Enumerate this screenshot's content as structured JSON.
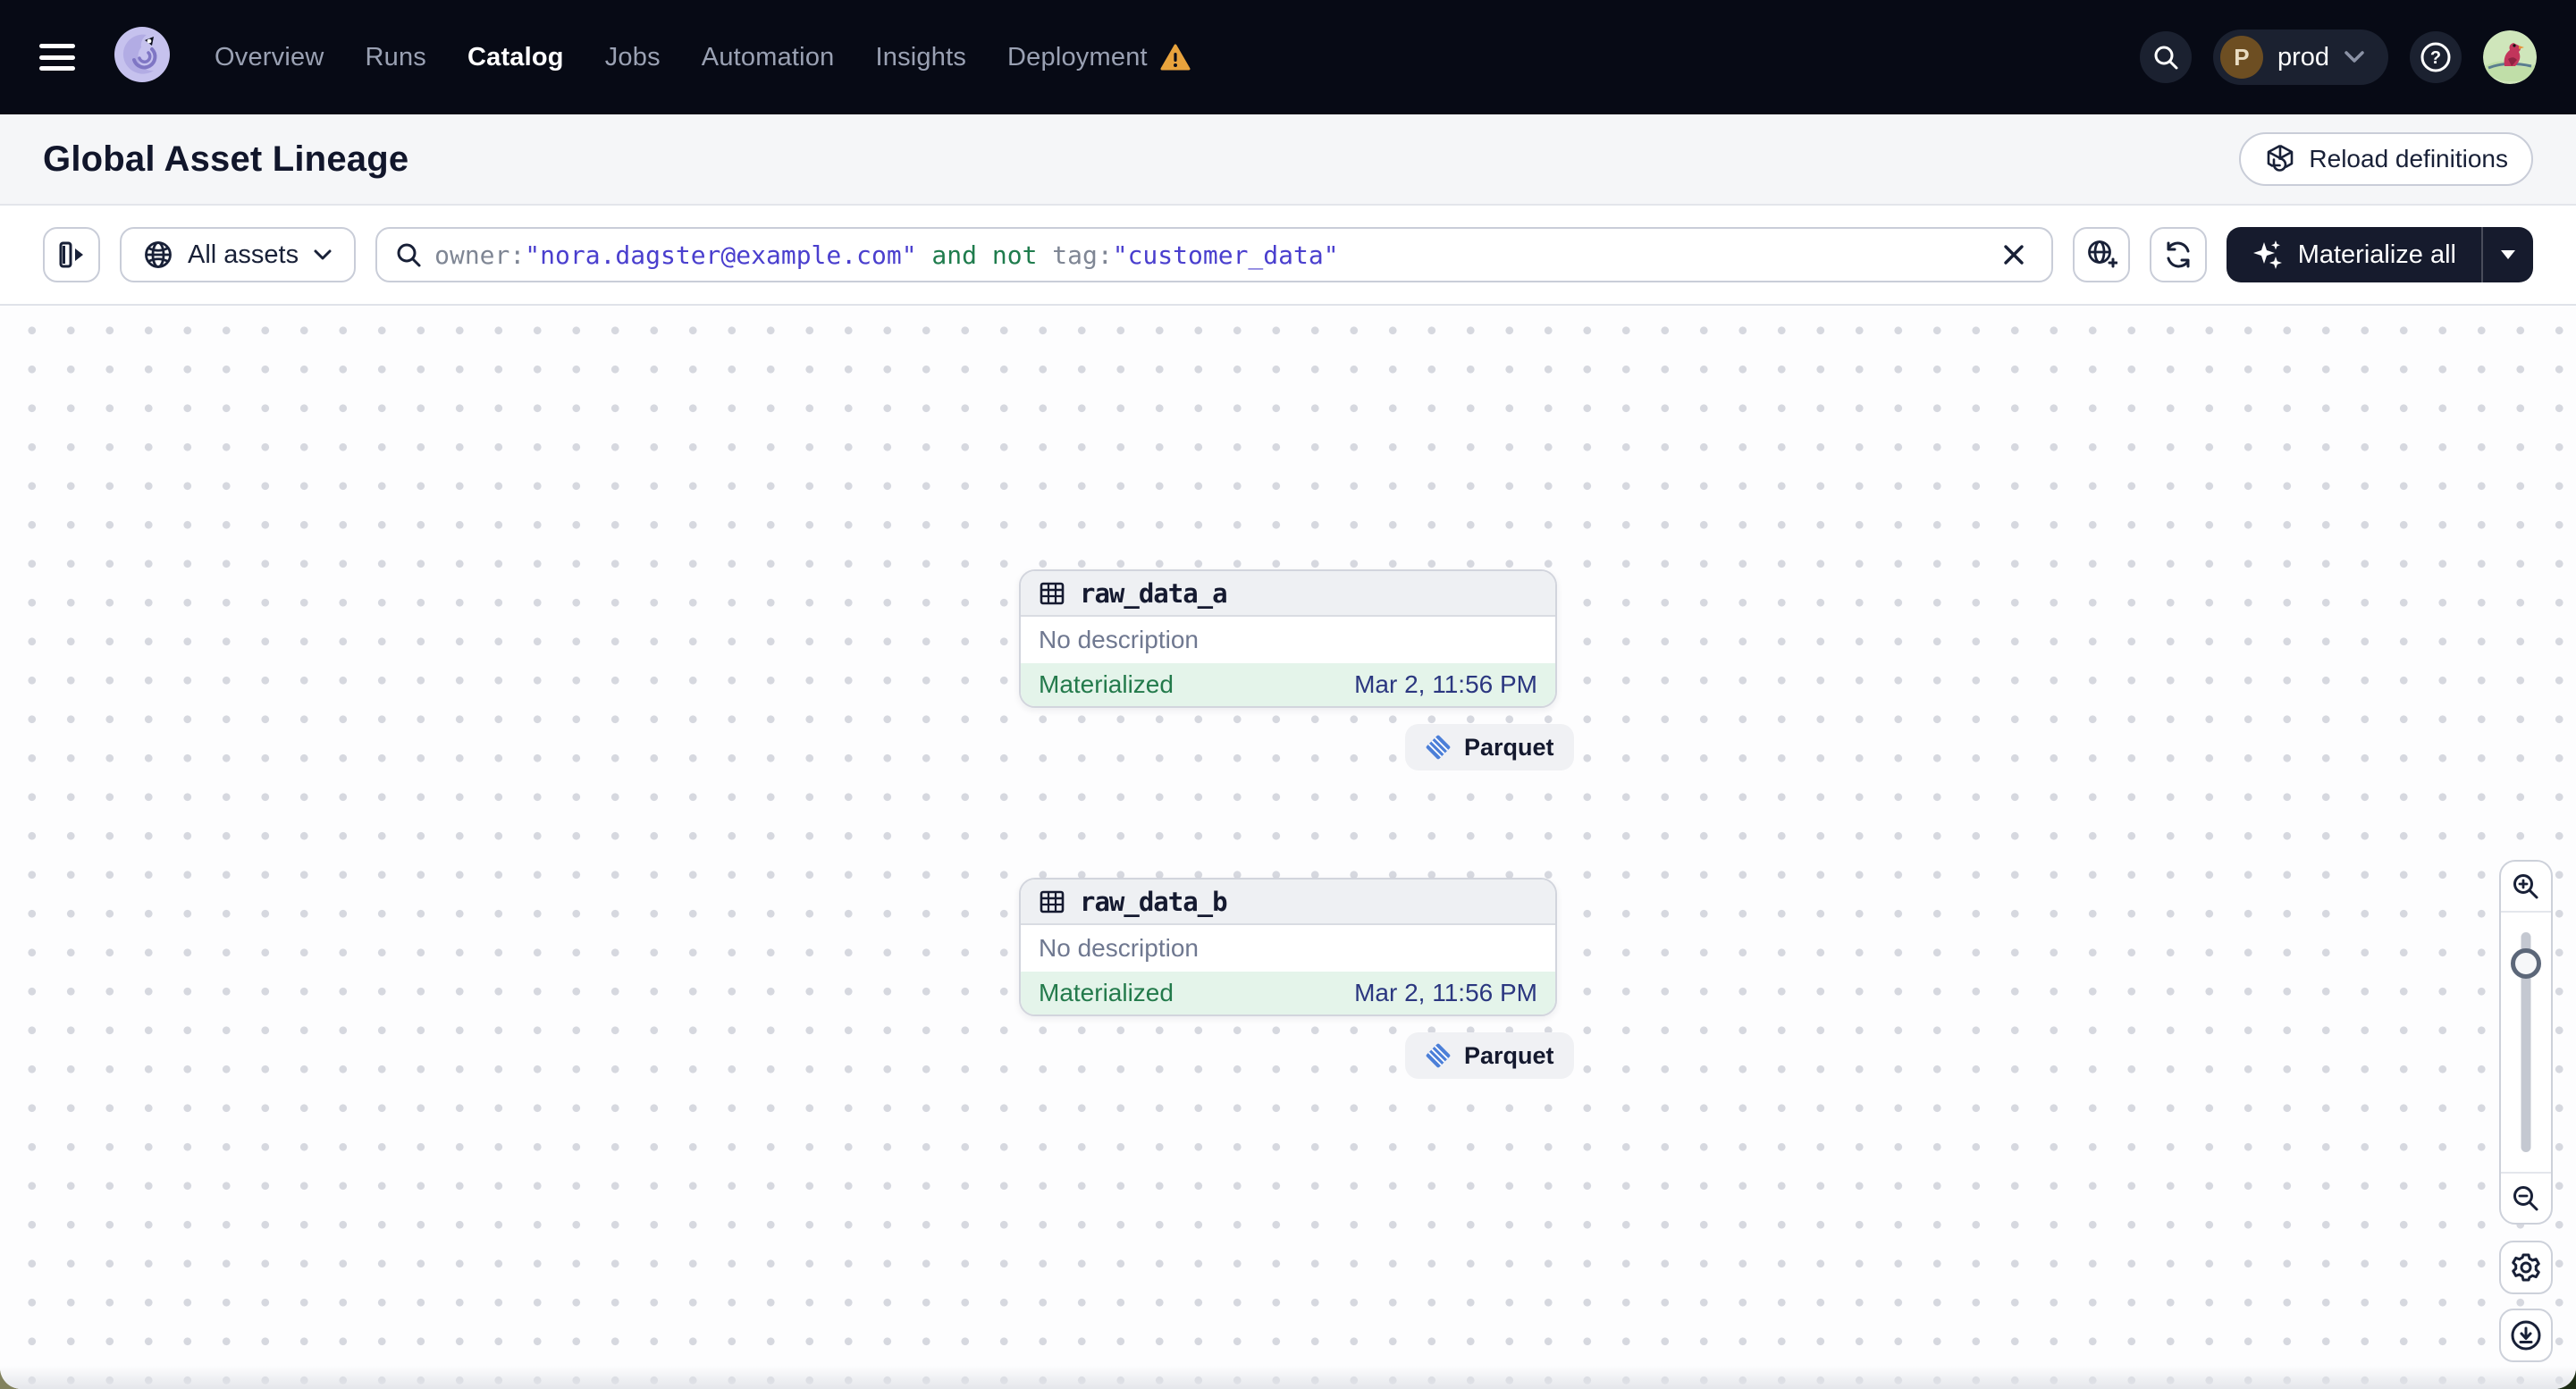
{
  "nav": {
    "items": [
      {
        "label": "Overview"
      },
      {
        "label": "Runs"
      },
      {
        "label": "Catalog",
        "active": true
      },
      {
        "label": "Jobs"
      },
      {
        "label": "Automation"
      },
      {
        "label": "Insights"
      },
      {
        "label": "Deployment",
        "warning": true
      }
    ],
    "environment": {
      "initial": "P",
      "name": "prod"
    }
  },
  "header": {
    "title": "Global Asset Lineage",
    "reload_label": "Reload definitions"
  },
  "toolbar": {
    "scope_label": "All assets",
    "search": {
      "tokens": [
        {
          "type": "key",
          "text": "owner:"
        },
        {
          "type": "value",
          "text": "\"nora.dagster@example.com\""
        },
        {
          "type": "operator",
          "text": " and not "
        },
        {
          "type": "key",
          "text": "tag:"
        },
        {
          "type": "value",
          "text": "\"customer_data\""
        }
      ]
    },
    "materialize_label": "Materialize all"
  },
  "graph": {
    "nodes": [
      {
        "name": "raw_data_a",
        "description": "No description",
        "status": "Materialized",
        "timestamp": "Mar 2, 11:56 PM",
        "tag": "Parquet"
      },
      {
        "name": "raw_data_b",
        "description": "No description",
        "status": "Materialized",
        "timestamp": "Mar 2, 11:56 PM",
        "tag": "Parquet"
      }
    ]
  },
  "colors": {
    "nav_bg": "#070a15",
    "warning": "#e8a33d",
    "query_value": "#4a3fce",
    "query_operator": "#1f7c4d",
    "query_key": "#7f8694",
    "materialized_bg": "#e4f4ea",
    "materialized_text": "#237a4b",
    "timestamp_text": "#2b3780",
    "parquet_blue": "#4c7fd8",
    "dark_button": "#161b2d"
  }
}
